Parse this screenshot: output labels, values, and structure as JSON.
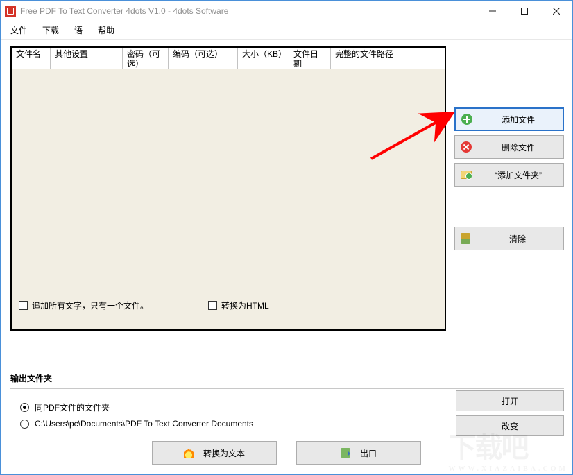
{
  "window": {
    "title": "Free PDF To Text Converter 4dots V1.0 - 4dots Software"
  },
  "menu": {
    "file": "文件",
    "download": "下载",
    "language": "语",
    "help": "帮助"
  },
  "table": {
    "columns": {
      "filename": "文件名",
      "other_settings": "其他设置",
      "password": "密码（可选）",
      "encoding": "编码（可选）",
      "size": "大小（KB）",
      "file_date": "文件日期",
      "full_path": "完整的文件路径"
    }
  },
  "list_options": {
    "append_all": "追加所有文字，只有一个文件。",
    "convert_html": "转换为HTML"
  },
  "side_buttons": {
    "add_file": "添加文件",
    "delete_file": "删除文件",
    "add_folder": "“添加文件夹”",
    "clear": "清除"
  },
  "output": {
    "group_title": "输出文件夹",
    "same_folder": "同PDF文件的文件夹",
    "custom_path": "C:\\Users\\pc\\Documents\\PDF To Text Converter Documents",
    "open": "打开",
    "change": "改变"
  },
  "bottom": {
    "convert": "转换为文本",
    "exit": "出口"
  },
  "watermark": {
    "main": "下载吧",
    "sub": "WWW.XIAZAIBA.COM"
  }
}
